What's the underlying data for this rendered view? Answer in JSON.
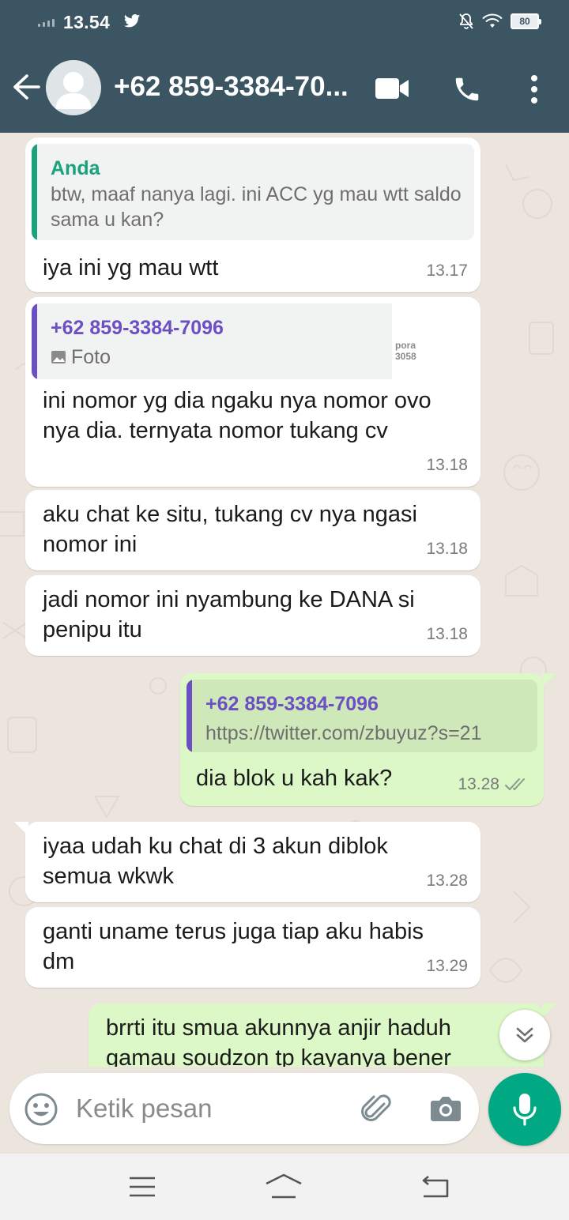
{
  "status_bar": {
    "time": "13.54",
    "battery": "80"
  },
  "header": {
    "contact": "+62 859-3384-70..."
  },
  "messages": [
    {
      "direction": "in",
      "quote": {
        "name": "Anda",
        "body": "btw, maaf nanya lagi. ini ACC yg mau wtt saldo sama u kan?"
      },
      "text": "iya ini yg mau wtt",
      "time": "13.17"
    },
    {
      "direction": "in",
      "quote": {
        "name": "+62 859-3384-7096",
        "body": "Foto",
        "thumb_text": "pora\n3058"
      },
      "text": "ini nomor yg dia ngaku nya nomor ovo nya dia. ternyata nomor tukang cv",
      "time": "13.18"
    },
    {
      "direction": "in",
      "text": "aku chat ke situ, tukang cv nya ngasi nomor ini",
      "time": "13.18"
    },
    {
      "direction": "in",
      "text": "jadi nomor ini nyambung ke DANA si penipu itu",
      "time": "13.18"
    },
    {
      "direction": "out",
      "quote": {
        "name": "+62 859-3384-7096",
        "body": "https://twitter.com/zbuyuz?s=21"
      },
      "text": "dia blok u kah kak?",
      "time": "13.28"
    },
    {
      "direction": "in",
      "text": "iyaa udah ku chat di 3 akun diblok semua wkwk",
      "time": "13.28"
    },
    {
      "direction": "in",
      "text": "ganti uname terus juga tiap aku habis dm",
      "time": "13.29"
    },
    {
      "direction": "out",
      "text": "brrti itu smua akunnya anjir haduh gamau soudzon tp kayanya bener",
      "time": ""
    }
  ],
  "composer": {
    "placeholder": "Ketik pesan"
  },
  "colors": {
    "header": "#3b5563",
    "accent_green": "#00a884",
    "outgoing_bubble": "#dcf8c6",
    "quote_self": "#1aa37a",
    "quote_contact": "#6b4fc3"
  },
  "icons": [
    "back-arrow-icon",
    "avatar-icon",
    "video-call-icon",
    "voice-call-icon",
    "more-menu-icon",
    "emoji-icon",
    "attach-icon",
    "camera-icon",
    "mic-icon",
    "scroll-down-icon",
    "double-check-icon",
    "image-icon"
  ]
}
